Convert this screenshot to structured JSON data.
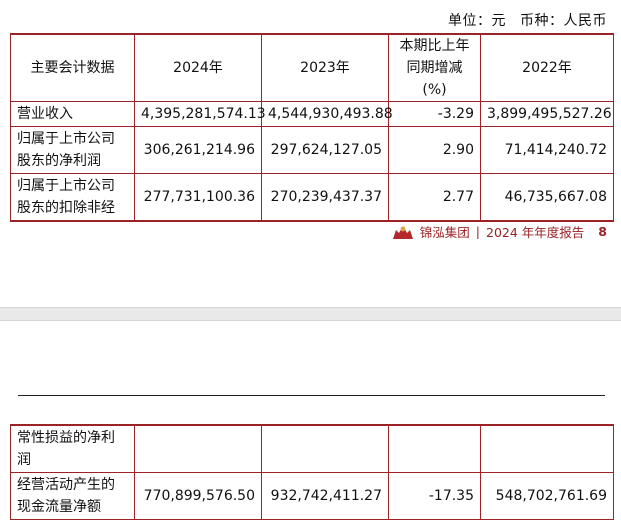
{
  "header": {
    "unit": "单位：元",
    "currency": "币种：人民币"
  },
  "table": {
    "columns": [
      "主要会计数据",
      "2024年",
      "2023年",
      "本期比上年同期增减(%)",
      "2022年"
    ],
    "column_change_line1": "本期比上年",
    "column_change_line2": "同期增减(%)",
    "rows": [
      {
        "label": "营业收入",
        "v2024": "4,395,281,574.13",
        "v2023": "4,544,930,493.88",
        "change": "-3.29",
        "v2022": "3,899,495,527.26"
      },
      {
        "label_line1": "归属于上市公司",
        "label_line2": "股东的净利润",
        "v2024": "306,261,214.96",
        "v2023": "297,624,127.05",
        "change": "2.90",
        "v2022": "71,414,240.72"
      },
      {
        "label_line1": "归属于上市公司",
        "label_line2": "股东的扣除非经",
        "v2024": "277,731,100.36",
        "v2023": "270,239,437.37",
        "change": "2.77",
        "v2022": "46,735,667.08"
      }
    ]
  },
  "footer": {
    "brand": "锦泓集团",
    "separator": "|",
    "report": "2024 年年度报告",
    "page": "8"
  },
  "table_cont": {
    "rows": [
      {
        "label_line1": "常性损益的净利",
        "label_line2": "润",
        "v2024": "",
        "v2023": "",
        "change": "",
        "v2022": ""
      },
      {
        "label_line1": "经营活动产生的",
        "label_line2": "现金流量净额",
        "v2024": "770,899,576.50",
        "v2023": "932,742,411.27",
        "change": "-17.35",
        "v2022": "548,702,761.69"
      }
    ]
  },
  "colors": {
    "rule": "#9b2226",
    "gap": "#e9e9ea"
  }
}
